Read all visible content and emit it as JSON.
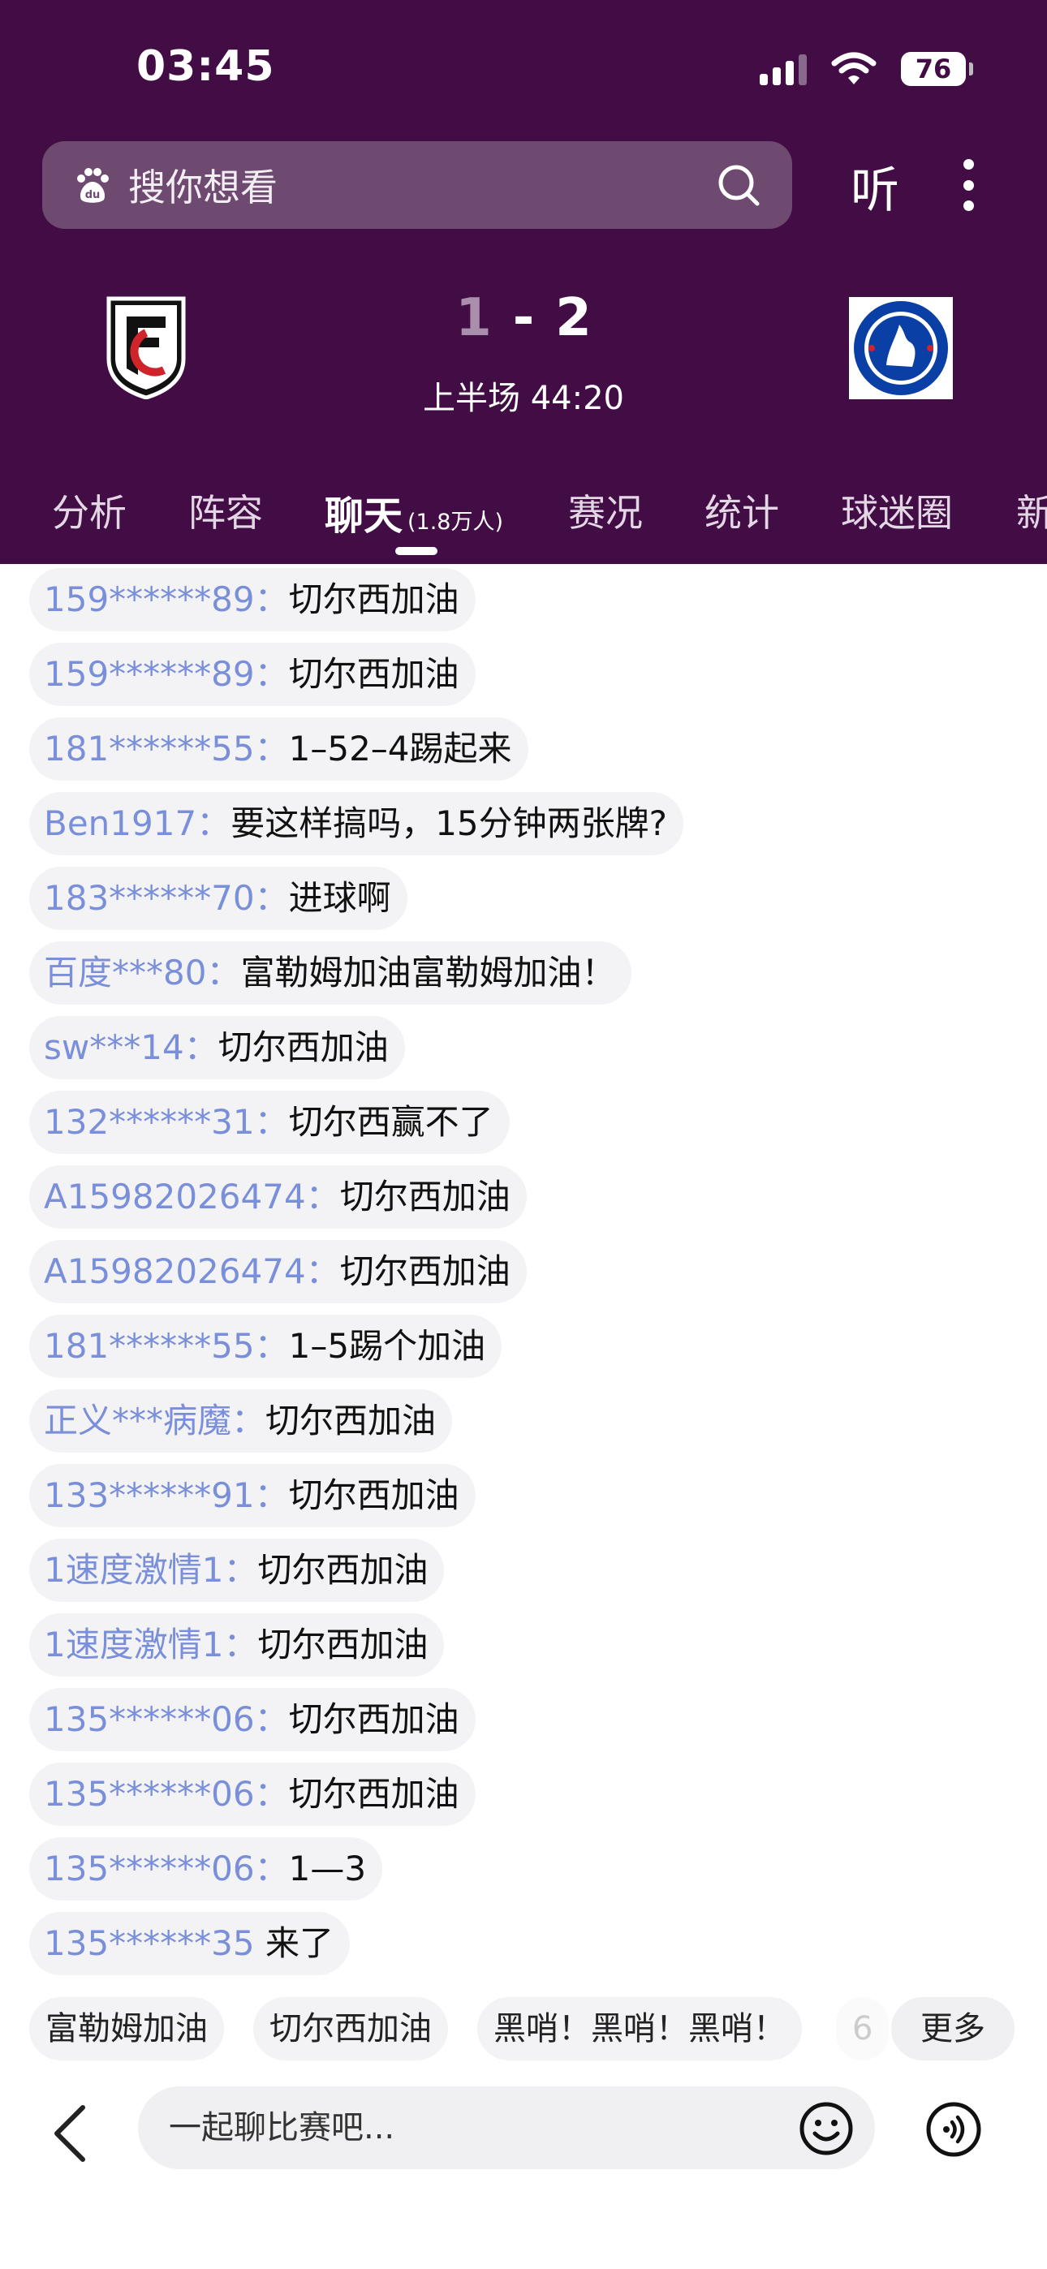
{
  "status_bar": {
    "time": "03:45",
    "battery": "76"
  },
  "search": {
    "placeholder": "搜你想看"
  },
  "header_actions": {
    "listen": "听"
  },
  "match": {
    "home_score": "1",
    "separator": "-",
    "away_score": "2",
    "period": "上半场 44:20"
  },
  "tabs": [
    {
      "label": "分析"
    },
    {
      "label": "阵容"
    },
    {
      "label": "聊天",
      "sub": "(1.8万人)"
    },
    {
      "label": "赛况"
    },
    {
      "label": "统计"
    },
    {
      "label": "球迷圈"
    },
    {
      "label": "新"
    }
  ],
  "messages": [
    {
      "user": "159******89",
      "sep": "：",
      "text": "切尔西加油"
    },
    {
      "user": "159******89",
      "sep": "：",
      "text": "切尔西加油"
    },
    {
      "user": "181******55",
      "sep": "：",
      "text": "1–52–4踢起来"
    },
    {
      "user": "Ben1917",
      "sep": "：",
      "text": "要这样搞吗，15分钟两张牌?"
    },
    {
      "user": "183******70",
      "sep": "：",
      "text": "进球啊"
    },
    {
      "user": "百度***80",
      "sep": "：",
      "text": "富勒姆加油富勒姆加油！"
    },
    {
      "user": "sw***14",
      "sep": "：",
      "text": "切尔西加油"
    },
    {
      "user": "132******31",
      "sep": "：",
      "text": "切尔西赢不了"
    },
    {
      "user": "A15982026474",
      "sep": "：",
      "text": "切尔西加油"
    },
    {
      "user": "A15982026474",
      "sep": "：",
      "text": "切尔西加油"
    },
    {
      "user": "181******55",
      "sep": "：",
      "text": "1–5踢个加油"
    },
    {
      "user": "正义***病魔",
      "sep": "：",
      "text": "切尔西加油"
    },
    {
      "user": "133******91",
      "sep": "：",
      "text": "切尔西加油"
    },
    {
      "user": "1速度激情1",
      "sep": "：",
      "text": "切尔西加油"
    },
    {
      "user": "1速度激情1",
      "sep": "：",
      "text": "切尔西加油"
    },
    {
      "user": "135******06",
      "sep": "：",
      "text": "切尔西加油"
    },
    {
      "user": "135******06",
      "sep": "：",
      "text": "切尔西加油"
    },
    {
      "user": "135******06",
      "sep": "：",
      "text": "1—3"
    },
    {
      "user": "135******35",
      "sep": " ",
      "text": "来了"
    }
  ],
  "quick_replies": [
    {
      "label": "富勒姆加油"
    },
    {
      "label": "切尔西加油"
    },
    {
      "label": "黑哨！黑哨！黑哨！"
    },
    {
      "label": "6"
    }
  ],
  "quick_more": "更多",
  "composer": {
    "placeholder": "一起聊比赛吧..."
  },
  "colors": {
    "header_bg": "#420c45",
    "username": "#7a8fda",
    "chelsea_blue": "#0a3fa6",
    "fulham_red": "#d0242b"
  }
}
